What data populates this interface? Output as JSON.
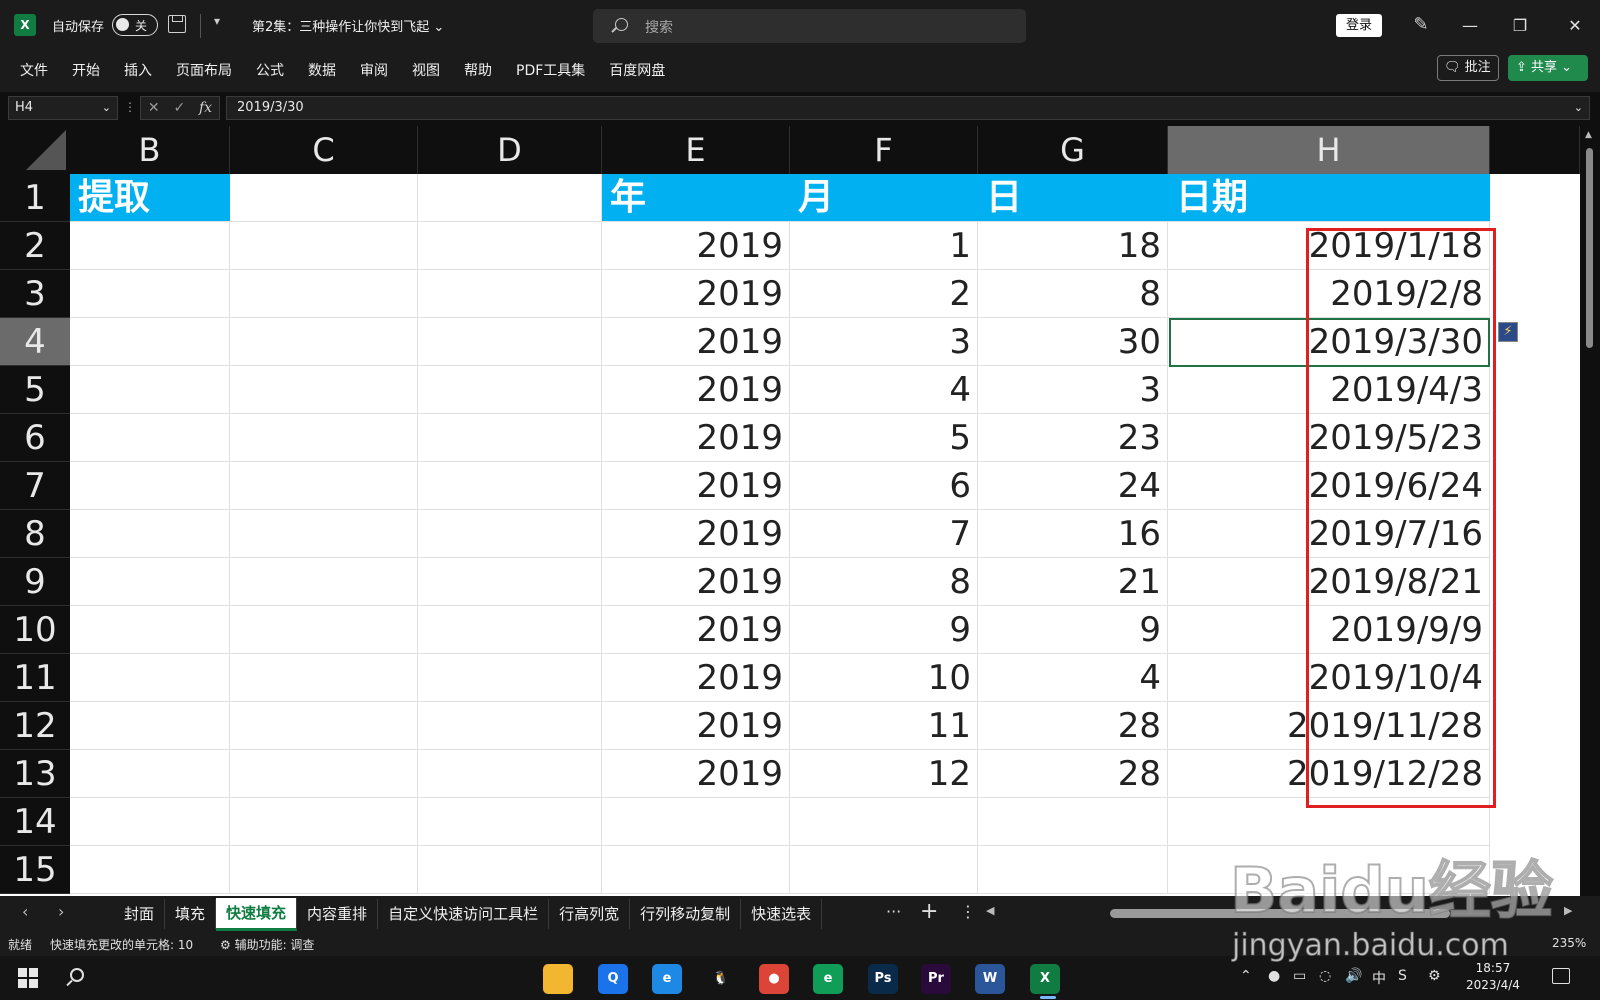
{
  "titlebar": {
    "logo": "X",
    "autosave_label": "自动保存",
    "autosave_state": "关",
    "qat_dropdown": "▾",
    "doc_title": "第2集：三种操作让你快到飞起 ⌄",
    "search_placeholder": "搜索",
    "login_label": "登录",
    "pen_icon": "✎",
    "min_label": "—",
    "max_label": "❐",
    "close_label": "✕"
  },
  "ribbon": {
    "tabs": [
      "文件",
      "开始",
      "插入",
      "页面布局",
      "公式",
      "数据",
      "审阅",
      "视图",
      "帮助",
      "PDF工具集",
      "百度网盘"
    ],
    "comment_label": "🗨 批注",
    "share_label": "⇪ 共享 ⌄"
  },
  "formula_bar": {
    "cell_ref": "H4",
    "dropdown": "⌄",
    "dots": "⋮",
    "cancel_icon": "✕",
    "enter_icon": "✓",
    "fx_label": "fx",
    "formula": "2019/3/30"
  },
  "grid": {
    "columns": [
      "B",
      "C",
      "D",
      "E",
      "F",
      "G",
      "H"
    ],
    "active_column": "H",
    "rows": [
      "1",
      "2",
      "3",
      "4",
      "5",
      "6",
      "7",
      "8",
      "9",
      "10",
      "11",
      "12",
      "13",
      "14",
      "15"
    ],
    "active_row": "4",
    "header_row": {
      "B": "提取",
      "E": "年",
      "F": "月",
      "G": "日",
      "H": "日期"
    },
    "data": [
      {
        "E": "2019",
        "F": "1",
        "G": "18",
        "H": "2019/1/18"
      },
      {
        "E": "2019",
        "F": "2",
        "G": "8",
        "H": "2019/2/8"
      },
      {
        "E": "2019",
        "F": "3",
        "G": "30",
        "H": "2019/3/30"
      },
      {
        "E": "2019",
        "F": "4",
        "G": "3",
        "H": "2019/4/3"
      },
      {
        "E": "2019",
        "F": "5",
        "G": "23",
        "H": "2019/5/23"
      },
      {
        "E": "2019",
        "F": "6",
        "G": "24",
        "H": "2019/6/24"
      },
      {
        "E": "2019",
        "F": "7",
        "G": "16",
        "H": "2019/7/16"
      },
      {
        "E": "2019",
        "F": "8",
        "G": "21",
        "H": "2019/8/21"
      },
      {
        "E": "2019",
        "F": "9",
        "G": "9",
        "H": "2019/9/9"
      },
      {
        "E": "2019",
        "F": "10",
        "G": "4",
        "H": "2019/10/4"
      },
      {
        "E": "2019",
        "F": "11",
        "G": "28",
        "H": "2019/11/28"
      },
      {
        "E": "2019",
        "F": "12",
        "G": "28",
        "H": "2019/12/28"
      }
    ],
    "flashfill_icon": "⚡",
    "header_color": "#00b0f0",
    "highlight_color": "#e02020"
  },
  "sheet_tabs": {
    "prev": "‹",
    "next": "›",
    "tabs": [
      "封面",
      "填充",
      "快速填充",
      "内容重排",
      "自定义快速访问工具栏",
      "行高列宽",
      "行列移动复制",
      "快速选表"
    ],
    "active_tab": "快速填充",
    "more": "···",
    "add": "+",
    "menu": "⋮",
    "hs_left": "◀",
    "hs_right": "▶"
  },
  "status_bar": {
    "ready": "就绪",
    "flashfill_info": "快速填充更改的单元格: 10",
    "accessibility": "⚙ 辅助功能: 调查",
    "zoom": "235%"
  },
  "taskbar": {
    "apps": [
      {
        "name": "file-explorer",
        "label": "",
        "color": "#f2b630"
      },
      {
        "name": "baidu-netdisk",
        "label": "Q",
        "color": "#1a73e8"
      },
      {
        "name": "edge-legacy",
        "label": "e",
        "color": "#1e88e5"
      },
      {
        "name": "qq",
        "label": "🐧",
        "color": "#141414"
      },
      {
        "name": "chrome",
        "label": "●",
        "color": "#db4437"
      },
      {
        "name": "edge",
        "label": "e",
        "color": "#0f9d58"
      },
      {
        "name": "photoshop",
        "label": "Ps",
        "color": "#0a2a4a"
      },
      {
        "name": "premiere",
        "label": "Pr",
        "color": "#2a0a3a"
      },
      {
        "name": "word",
        "label": "W",
        "color": "#2b579a"
      },
      {
        "name": "excel",
        "label": "X",
        "color": "#107c41"
      }
    ],
    "tray_items": [
      "⌃",
      "●",
      "▭",
      "◌",
      "🔊",
      "中",
      "S",
      "⚙"
    ],
    "time": "18:57",
    "date": "2023/4/4"
  },
  "watermark": {
    "brand": "Baidu经验",
    "url": "jingyan.baidu.com"
  }
}
